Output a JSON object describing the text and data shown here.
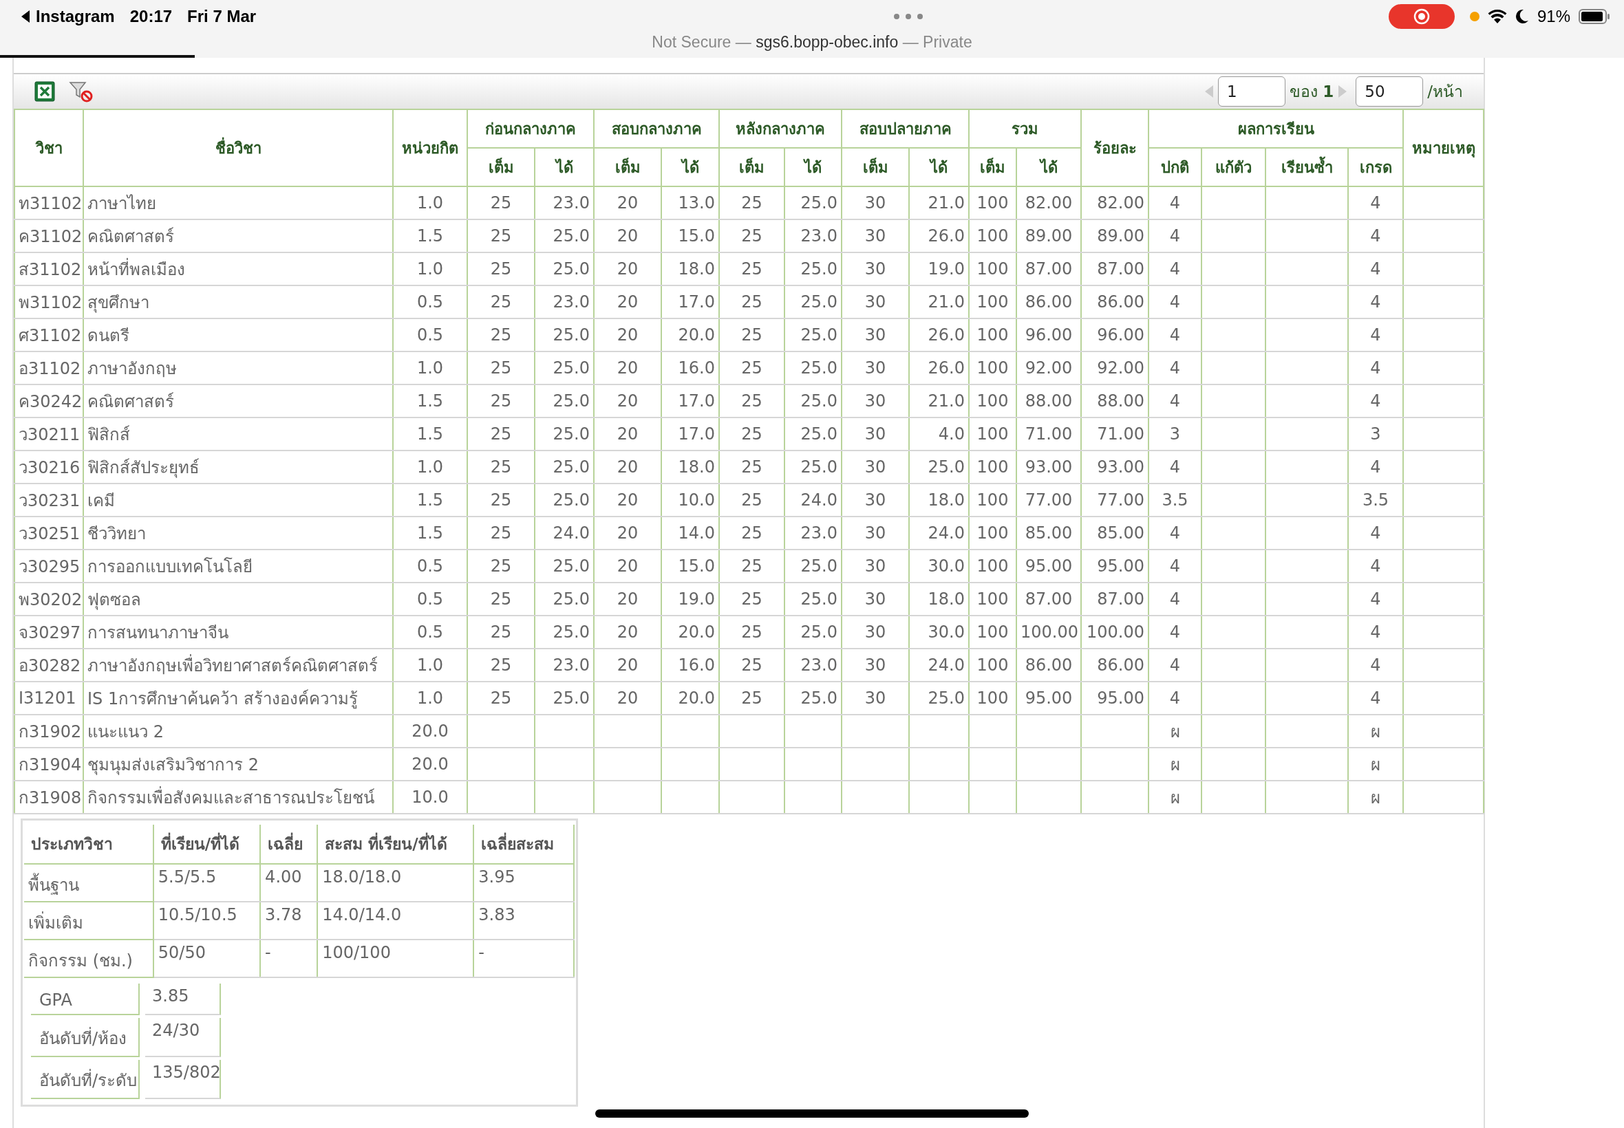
{
  "status_bar": {
    "back_label": "Instagram",
    "time": "20:17",
    "date": "Fri 7 Mar",
    "battery": "91%",
    "recording": true
  },
  "browser": {
    "prefix": "Not Secure —",
    "domain": "sgs6.bopp-obec.info",
    "suffix": "— Private",
    "load_progress": {
      "level": 0.12
    }
  },
  "pager": {
    "page": "1",
    "of_label": "ของ",
    "total": "1",
    "per_page": "50",
    "per_page_label": "/หน้า"
  },
  "grades": {
    "columns": [
      {
        "label": "วิชา"
      },
      {
        "label": "ชื่อวิชา"
      },
      {
        "label": "หน่วยกิต"
      },
      {
        "label": "ก่อนกลางภาค",
        "colspan": 2,
        "sub": [
          "เต็ม",
          "ได้"
        ]
      },
      {
        "label": "สอบกลางภาค",
        "colspan": 2,
        "sub": [
          "เต็ม",
          "ได้"
        ]
      },
      {
        "label": "หลังกลางภาค",
        "colspan": 2,
        "sub": [
          "เต็ม",
          "ได้"
        ]
      },
      {
        "label": "สอบปลายภาค",
        "colspan": 2,
        "sub": [
          "เต็ม",
          "ได้"
        ]
      },
      {
        "label": "รวม",
        "colspan": 2,
        "sub": [
          "เต็ม",
          "ได้"
        ]
      },
      {
        "label": "ร้อยละ"
      },
      {
        "label": "ผลการเรียน",
        "colspan": 4,
        "sub": [
          "ปกติ",
          "แก้ตัว",
          "เรียนซ้ำ",
          "เกรด"
        ]
      },
      {
        "label": "หมายเหตุ"
      }
    ],
    "rows": [
      [
        "ท31102",
        "ภาษาไทย",
        "1.0",
        "25",
        "23.0",
        "20",
        "13.0",
        "25",
        "25.0",
        "30",
        "21.0",
        "100",
        "82.00",
        "82.00",
        "4",
        null,
        null,
        "4"
      ],
      [
        "ค31102",
        "คณิตศาสตร์",
        "1.5",
        "25",
        "25.0",
        "20",
        "15.0",
        "25",
        "23.0",
        "30",
        "26.0",
        "100",
        "89.00",
        "89.00",
        "4",
        null,
        null,
        "4"
      ],
      [
        "ส31102",
        "หน้าที่พลเมือง",
        "1.0",
        "25",
        "25.0",
        "20",
        "18.0",
        "25",
        "25.0",
        "30",
        "19.0",
        "100",
        "87.00",
        "87.00",
        "4",
        null,
        null,
        "4"
      ],
      [
        "พ31102",
        "สุขศึกษา",
        "0.5",
        "25",
        "23.0",
        "20",
        "17.0",
        "25",
        "25.0",
        "30",
        "21.0",
        "100",
        "86.00",
        "86.00",
        "4",
        null,
        null,
        "4"
      ],
      [
        "ศ31102",
        "ดนตรี",
        "0.5",
        "25",
        "25.0",
        "20",
        "20.0",
        "25",
        "25.0",
        "30",
        "26.0",
        "100",
        "96.00",
        "96.00",
        "4",
        null,
        null,
        "4"
      ],
      [
        "อ31102",
        "ภาษาอังกฤษ",
        "1.0",
        "25",
        "25.0",
        "20",
        "16.0",
        "25",
        "25.0",
        "30",
        "26.0",
        "100",
        "92.00",
        "92.00",
        "4",
        null,
        null,
        "4"
      ],
      [
        "ค30242",
        "คณิตศาสตร์",
        "1.5",
        "25",
        "25.0",
        "20",
        "17.0",
        "25",
        "25.0",
        "30",
        "21.0",
        "100",
        "88.00",
        "88.00",
        "4",
        null,
        null,
        "4"
      ],
      [
        "ว30211",
        "ฟิสิกส์",
        "1.5",
        "25",
        "25.0",
        "20",
        "17.0",
        "25",
        "25.0",
        "30",
        "4.0",
        "100",
        "71.00",
        "71.00",
        "3",
        null,
        null,
        "3"
      ],
      [
        "ว30216",
        "ฟิสิกส์สัประยุทธ์",
        "1.0",
        "25",
        "25.0",
        "20",
        "18.0",
        "25",
        "25.0",
        "30",
        "25.0",
        "100",
        "93.00",
        "93.00",
        "4",
        null,
        null,
        "4"
      ],
      [
        "ว30231",
        "เคมี",
        "1.5",
        "25",
        "25.0",
        "20",
        "10.0",
        "25",
        "24.0",
        "30",
        "18.0",
        "100",
        "77.00",
        "77.00",
        "3.5",
        null,
        null,
        "3.5"
      ],
      [
        "ว30251",
        "ชีววิทยา",
        "1.5",
        "25",
        "24.0",
        "20",
        "14.0",
        "25",
        "23.0",
        "30",
        "24.0",
        "100",
        "85.00",
        "85.00",
        "4",
        null,
        null,
        "4"
      ],
      [
        "ว30295",
        "การออกแบบเทคโนโลยี",
        "0.5",
        "25",
        "25.0",
        "20",
        "15.0",
        "25",
        "25.0",
        "30",
        "30.0",
        "100",
        "95.00",
        "95.00",
        "4",
        null,
        null,
        "4"
      ],
      [
        "พ30202",
        "ฟุตซอล",
        "0.5",
        "25",
        "25.0",
        "20",
        "19.0",
        "25",
        "25.0",
        "30",
        "18.0",
        "100",
        "87.00",
        "87.00",
        "4",
        null,
        null,
        "4"
      ],
      [
        "จ30297",
        "การสนทนาภาษาจีน",
        "0.5",
        "25",
        "25.0",
        "20",
        "20.0",
        "25",
        "25.0",
        "30",
        "30.0",
        "100",
        "100.00",
        "100.00",
        "4",
        null,
        null,
        "4"
      ],
      [
        "อ30282",
        "ภาษาอังกฤษเพื่อวิทยาศาสตร์คณิตศาสตร์",
        "1.0",
        "25",
        "23.0",
        "20",
        "16.0",
        "25",
        "23.0",
        "30",
        "24.0",
        "100",
        "86.00",
        "86.00",
        "4",
        null,
        null,
        "4"
      ],
      [
        "I31201",
        "IS 1การศึกษาค้นคว้า สร้างองค์ความรู้",
        "1.0",
        "25",
        "25.0",
        "20",
        "20.0",
        "25",
        "25.0",
        "30",
        "25.0",
        "100",
        "95.00",
        "95.00",
        "4",
        null,
        null,
        "4"
      ],
      [
        "ก31902",
        "แนะแนว 2",
        "20.0",
        null,
        null,
        null,
        null,
        null,
        null,
        null,
        null,
        null,
        null,
        null,
        "ผ",
        null,
        null,
        "ผ"
      ],
      [
        "ก31904",
        "ชุมนุมส่งเสริมวิชาการ 2",
        "20.0",
        null,
        null,
        null,
        null,
        null,
        null,
        null,
        null,
        null,
        null,
        null,
        "ผ",
        null,
        null,
        "ผ"
      ],
      [
        "ก31908",
        "กิจกรรมเพื่อสังคมและสาธารณประโยชน์",
        "10.0",
        null,
        null,
        null,
        null,
        null,
        null,
        null,
        null,
        null,
        null,
        null,
        "ผ",
        null,
        null,
        "ผ"
      ]
    ]
  },
  "summary": {
    "columns": [
      "ประเภทวิชา",
      "ที่เรียน/ที่ได้",
      "เฉลี่ย",
      "สะสม ที่เรียน/ที่ได้",
      "เฉลี่ยสะสม"
    ],
    "rows": [
      [
        "พื้นฐาน",
        "5.5/5.5",
        "4.00",
        "18.0/18.0",
        "3.95"
      ],
      [
        "เพิ่มเติม",
        "10.5/10.5",
        "3.78",
        "14.0/14.0",
        "3.83"
      ],
      [
        "กิจกรรม (ชม.)",
        "50/50",
        "-",
        "100/100",
        "-"
      ]
    ],
    "stats": [
      {
        "label": "GPA",
        "value": "3.85"
      },
      {
        "label": "อันดับที่/ห้อง",
        "value": "24/30"
      },
      {
        "label": "อันดับที่/ระดับ",
        "value": "135/802"
      }
    ]
  }
}
